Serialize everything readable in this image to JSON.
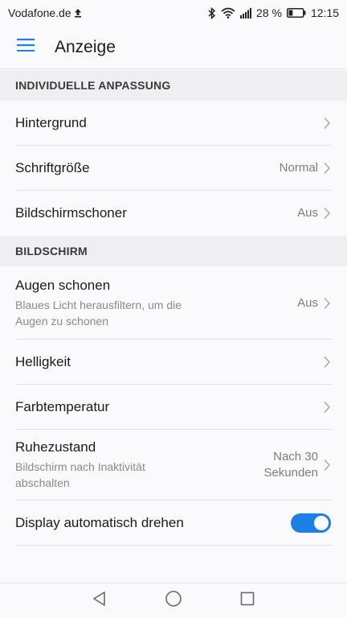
{
  "status_bar": {
    "carrier": "Vodafone.de",
    "battery_percent": "28 %",
    "battery_level": 0.28,
    "time": "12:15"
  },
  "header": {
    "title": "Anzeige"
  },
  "sections": {
    "customize": {
      "title": "INDIVIDUELLE ANPASSUNG",
      "items": [
        {
          "title": "Hintergrund"
        },
        {
          "title": "Schriftgröße",
          "value": "Normal"
        },
        {
          "title": "Bildschirmschoner",
          "value": "Aus"
        }
      ]
    },
    "screen": {
      "title": "BILDSCHIRM",
      "items": [
        {
          "title": "Augen schonen",
          "subtitle_line1": "Blaues Licht herausfiltern, um die",
          "subtitle_line2": "Augen zu schonen",
          "value": "Aus"
        },
        {
          "title": "Helligkeit"
        },
        {
          "title": "Farbtemperatur"
        },
        {
          "title": "Ruhezustand",
          "subtitle_line1": "Bildschirm nach Inaktivität",
          "subtitle_line2": "abschalten",
          "value_line1": "Nach 30",
          "value_line2": "Sekunden"
        },
        {
          "title": "Display automatisch drehen",
          "toggle_on": true
        }
      ]
    }
  },
  "colors": {
    "accent": "#1d7ee6",
    "background": "#faf9fb",
    "section_header_bg": "#efeef0"
  },
  "icons": {
    "menu": "hamburger-menu-icon",
    "chevron": "chevron-right-icon",
    "nav_back": "back-triangle-icon",
    "nav_home": "home-circle-icon",
    "nav_recent": "recent-square-icon"
  }
}
